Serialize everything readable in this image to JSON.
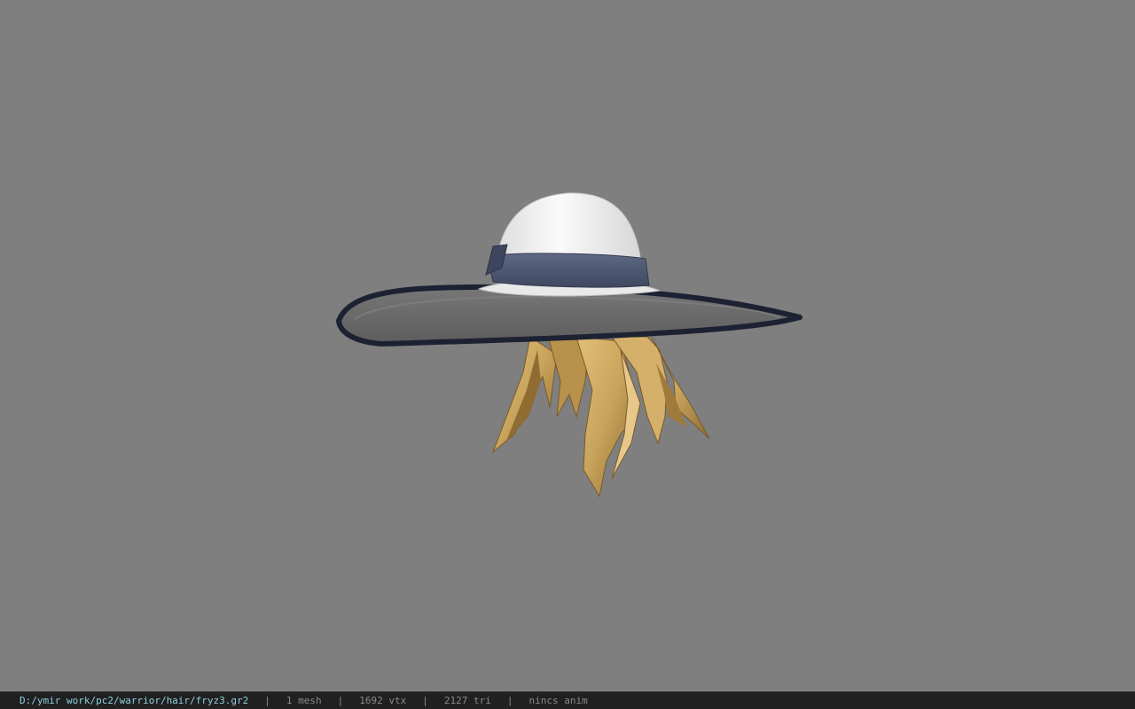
{
  "viewport": {
    "background": "#7f7f7f",
    "model": {
      "hat_crown_color": "#f2f2f2",
      "hat_band_color": "#4f5a74",
      "hat_brim_color": "#6b6b6b",
      "hat_brim_edge_color": "#1d2233",
      "hair_color": "#c9a45c"
    }
  },
  "status_bar": {
    "file_path": "D:/ymir work/pc2/warrior/hair/fryz3.gr2",
    "separator": "|",
    "mesh_count": "1 mesh",
    "vertex_count": "1692 vtx",
    "triangle_count": "2127 tri",
    "anim_status": "nincs anim",
    "path_color": "#8fd0e0",
    "text_color": "#8a8a8a"
  }
}
